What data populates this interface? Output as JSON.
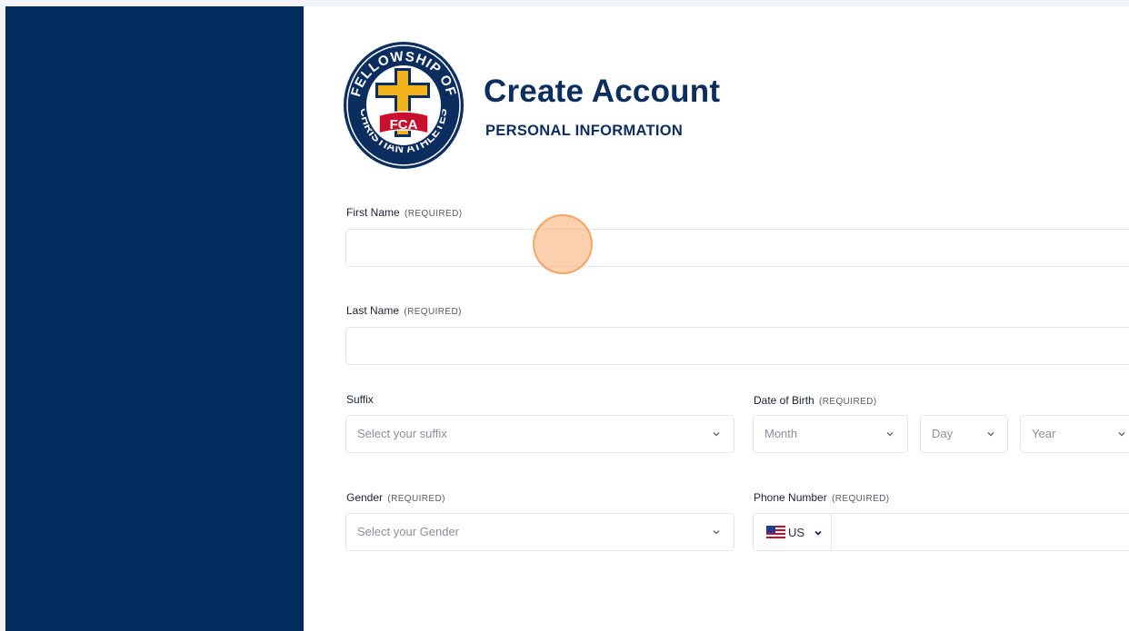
{
  "header": {
    "title": "Create Account",
    "subtitle": "PERSONAL INFORMATION",
    "logo_text": "FELLOWSHIP OF CHRISTIAN ATHLETES",
    "logo_badge": "FCA"
  },
  "form": {
    "first_name": {
      "label": "First Name",
      "required": "(REQUIRED)",
      "value": ""
    },
    "last_name": {
      "label": "Last Name",
      "required": "(REQUIRED)",
      "value": ""
    },
    "suffix": {
      "label": "Suffix",
      "placeholder": "Select your suffix"
    },
    "dob": {
      "label": "Date of Birth",
      "required": "(REQUIRED)",
      "month": "Month",
      "day": "Day",
      "year": "Year"
    },
    "gender": {
      "label": "Gender",
      "required": "(REQUIRED)",
      "placeholder": "Select your Gender"
    },
    "phone": {
      "label": "Phone Number",
      "required": "(REQUIRED)",
      "country": "US",
      "value": ""
    }
  },
  "colors": {
    "sidebar": "#002d5e",
    "brand_navy": "#0b2e5f",
    "logo_red": "#c8102e",
    "logo_gold": "#f2b31b",
    "click_marker": "#f6b078"
  },
  "icons": [
    "fca-logo",
    "chevron-down-icon",
    "us-flag-icon"
  ]
}
